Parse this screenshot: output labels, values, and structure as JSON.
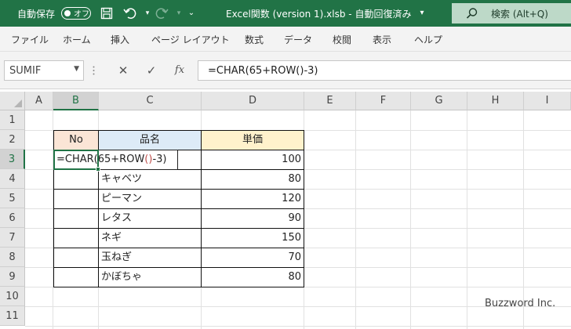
{
  "titlebar": {
    "autosave_label": "自動保存",
    "autosave_state": "オフ",
    "document_title": "Excel関数 (version 1).xlsb  -  自動回復済み",
    "search_placeholder": "検索 (Alt+Q)",
    "icons": [
      "save-icon",
      "undo-icon",
      "redo-icon",
      "customize-qat-icon",
      "search-icon"
    ]
  },
  "menu": {
    "items": [
      "ファイル",
      "ホーム",
      "挿入",
      "ページ レイアウト",
      "数式",
      "データ",
      "校閲",
      "表示",
      "ヘルプ"
    ]
  },
  "formula_bar": {
    "name_box": "SUMIF",
    "formula": "=CHAR(65+ROW()-3)"
  },
  "sheet": {
    "columns": [
      "A",
      "B",
      "C",
      "D",
      "E",
      "F",
      "G",
      "H",
      "I"
    ],
    "rows": [
      "1",
      "2",
      "3",
      "4",
      "5",
      "6",
      "7",
      "8",
      "9",
      "10",
      "11"
    ],
    "table": {
      "headers": {
        "no": "No",
        "name": "品名",
        "price": "単価"
      },
      "names": [
        "",
        "キャベツ",
        "ピーマン",
        "レタス",
        "ネギ",
        "玉ねぎ",
        "かぼちゃ"
      ],
      "prices": [
        "100",
        "80",
        "120",
        "90",
        "150",
        "70",
        "80"
      ]
    },
    "editing": {
      "prefix": "=CHAR(65+ROW",
      "paren": "()",
      "suffix": "-3)"
    }
  },
  "watermark": "Buzzword Inc.",
  "colors": {
    "excel_green": "#217346",
    "no_header": "#fbe5d6",
    "name_header": "#ddebf7",
    "price_header": "#fff2cc"
  }
}
